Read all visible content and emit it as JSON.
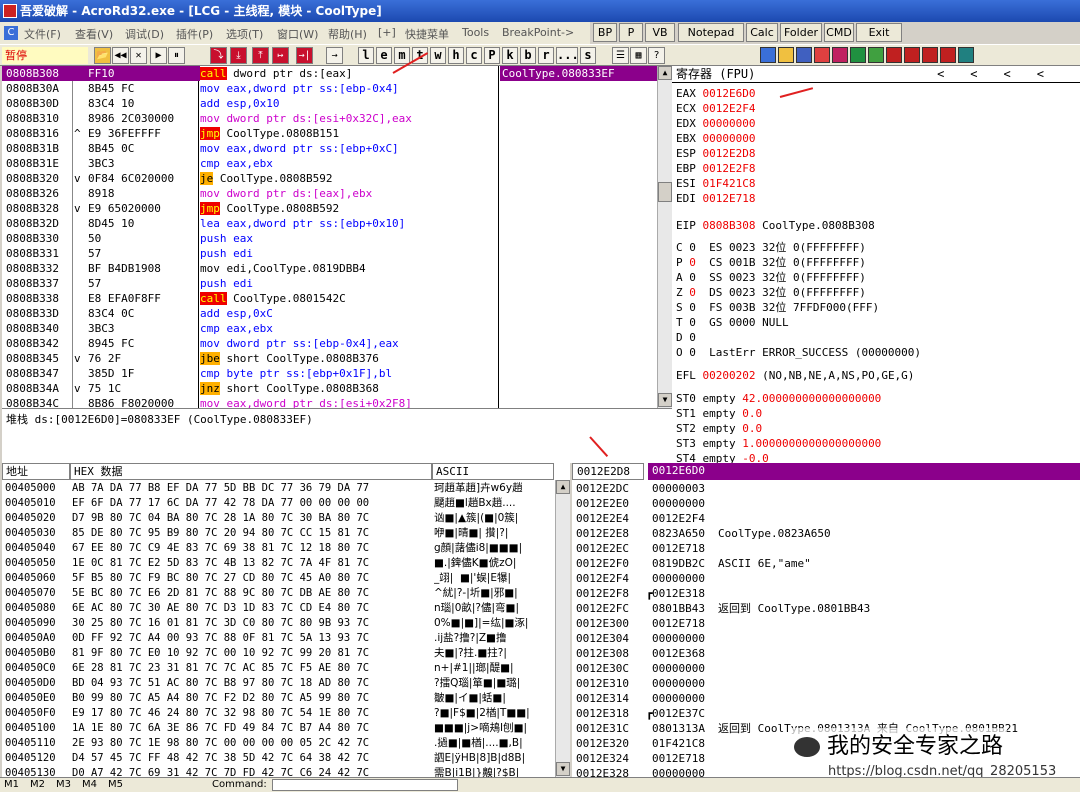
{
  "window": {
    "title": "吾爱破解 - AcroRd32.exe - [LCG - 主线程, 模块 - CoolType]",
    "buttons": [
      "BP",
      "P",
      "VB",
      "Notepad",
      "Calc",
      "Folder",
      "CMD",
      "Exit"
    ]
  },
  "menu": [
    "文件(F)",
    "查看(V)",
    "调试(D)",
    "插件(P)",
    "选项(T)",
    "窗口(W)",
    "帮助(H)",
    "[+]",
    "快捷菜单",
    "Tools",
    "BreakPoint->"
  ],
  "toolbar": {
    "status": "暂停",
    "buttons": [
      "📂",
      "◀◀",
      "✕",
      "▶",
      "⏸",
      "⤵",
      "⤓",
      "⤒",
      "↦",
      "→|"
    ],
    "letters": [
      "l",
      "e",
      "m",
      "t",
      "w",
      "h",
      "c",
      "P",
      "k",
      "b",
      "r",
      "...",
      "s"
    ]
  },
  "disasm": {
    "rows": [
      {
        "addr": "0808B308",
        "hex": "FF10",
        "op": "call",
        "args": " dword ptr ds:[eax]",
        "cls": "kw-call",
        "cmt": "CoolType.080833EF",
        "sel": true
      },
      {
        "addr": "0808B30A",
        "hex": "8B45 FC",
        "op": "mov",
        "args": " eax,dword ptr ss:[ebp-0x4]",
        "cls": "kw-blue"
      },
      {
        "addr": "0808B30D",
        "hex": "83C4 10",
        "op": "add",
        "args": " esp,0x10",
        "cls": "kw-blue"
      },
      {
        "addr": "0808B310",
        "hex": "8986 2C030000",
        "op": "mov",
        "args": " dword ptr ds:[esi+0x32C],eax",
        "cls": "kw-pink"
      },
      {
        "addr": "0808B316",
        "hex": "E9 36FEFFFF",
        "op": "jmp",
        "args": " CoolType.0808B151",
        "cls": "kw-jmp",
        "mark": "^"
      },
      {
        "addr": "0808B31B",
        "hex": "8B45 0C",
        "op": "mov",
        "args": " eax,dword ptr ss:[ebp+0xC]",
        "cls": "kw-blue"
      },
      {
        "addr": "0808B31E",
        "hex": "3BC3",
        "op": "cmp",
        "args": " eax,ebx",
        "cls": "kw-blue"
      },
      {
        "addr": "0808B320",
        "hex": "0F84 6C020000",
        "op": "je",
        "args": " CoolType.0808B592",
        "cls": "kw-jcc",
        "mark": "v"
      },
      {
        "addr": "0808B326",
        "hex": "8918",
        "op": "mov",
        "args": " dword ptr ds:[eax],ebx",
        "cls": "kw-pink"
      },
      {
        "addr": "0808B328",
        "hex": "E9 65020000",
        "op": "jmp",
        "args": " CoolType.0808B592",
        "cls": "kw-jmp",
        "mark": "v"
      },
      {
        "addr": "0808B32D",
        "hex": "8D45 10",
        "op": "lea",
        "args": " eax,dword ptr ss:[ebp+0x10]",
        "cls": "kw-blue"
      },
      {
        "addr": "0808B330",
        "hex": "50",
        "op": "push",
        "args": " eax",
        "cls": "kw-blue"
      },
      {
        "addr": "0808B331",
        "hex": "57",
        "op": "push",
        "args": " edi",
        "cls": "kw-blue"
      },
      {
        "addr": "0808B332",
        "hex": "BF B4DB1908",
        "op": "mov",
        "args": " edi,CoolType.0819DBB4",
        "cls": "kw-plain"
      },
      {
        "addr": "0808B337",
        "hex": "57",
        "op": "push",
        "args": " edi",
        "cls": "kw-blue"
      },
      {
        "addr": "0808B338",
        "hex": "E8 EFA0F8FF",
        "op": "call",
        "args": " CoolType.0801542C",
        "cls": "kw-call"
      },
      {
        "addr": "0808B33D",
        "hex": "83C4 0C",
        "op": "add",
        "args": " esp,0xC",
        "cls": "kw-blue"
      },
      {
        "addr": "0808B340",
        "hex": "3BC3",
        "op": "cmp",
        "args": " eax,ebx",
        "cls": "kw-blue"
      },
      {
        "addr": "0808B342",
        "hex": "8945 FC",
        "op": "mov",
        "args": " dword ptr ss:[ebp-0x4],eax",
        "cls": "kw-blue"
      },
      {
        "addr": "0808B345",
        "hex": "76 2F",
        "op": "jbe",
        "args": " short CoolType.0808B376",
        "cls": "kw-jcc",
        "mark": "v"
      },
      {
        "addr": "0808B347",
        "hex": "385D 1F",
        "op": "cmp",
        "args": " byte ptr ss:[ebp+0x1F],bl",
        "cls": "kw-blue"
      },
      {
        "addr": "0808B34A",
        "hex": "75 1C",
        "op": "jnz",
        "args": " short CoolType.0808B368",
        "cls": "kw-jcc",
        "mark": "v"
      },
      {
        "addr": "0808B34C",
        "hex": "8B86 F8020000",
        "op": "mov",
        "args": " eax,dword ptr ds:[esi+0x2F8]",
        "cls": "kw-pink"
      }
    ]
  },
  "info_line": "堆栈 ds:[0012E6D0]=080833EF (CoolType.080833EF)",
  "registers": {
    "header": "寄存器 (FPU)",
    "nav": [
      "<",
      "<",
      "<",
      "<"
    ],
    "gprs": [
      {
        "name": "EAX",
        "value": "0012E6D0"
      },
      {
        "name": "ECX",
        "value": "0012E2F4"
      },
      {
        "name": "EDX",
        "value": "00000000"
      },
      {
        "name": "EBX",
        "value": "00000000"
      },
      {
        "name": "ESP",
        "value": "0012E2D8"
      },
      {
        "name": "EBP",
        "value": "0012E2F8"
      },
      {
        "name": "ESI",
        "value": "01F421C8"
      },
      {
        "name": "EDI",
        "value": "0012E718"
      }
    ],
    "eip": {
      "name": "EIP",
      "value": "0808B308",
      "desc": "CoolType.0808B308"
    },
    "flags": [
      {
        "f": "C",
        "v": "0",
        "seg": "ES 0023 32位 0(FFFFFFFF)",
        "red": false
      },
      {
        "f": "P",
        "v": "0",
        "seg": "CS 001B 32位 0(FFFFFFFF)",
        "red": true
      },
      {
        "f": "A",
        "v": "0",
        "seg": "SS 0023 32位 0(FFFFFFFF)",
        "red": false
      },
      {
        "f": "Z",
        "v": "0",
        "seg": "DS 0023 32位 0(FFFFFFFF)",
        "red": true
      },
      {
        "f": "S",
        "v": "0",
        "seg": "FS 003B 32位 7FFDF000(FFF)",
        "red": false
      },
      {
        "f": "T",
        "v": "0",
        "seg": "GS 0000 NULL",
        "red": false
      },
      {
        "f": "D",
        "v": "0",
        "seg": "",
        "red": false
      },
      {
        "f": "O",
        "v": "0",
        "seg": "LastErr ERROR_SUCCESS (00000000)",
        "red": false
      }
    ],
    "efl": {
      "name": "EFL",
      "value": "00200202",
      "desc": "(NO,NB,NE,A,NS,PO,GE,G)"
    },
    "fpu": [
      {
        "name": "ST0 empty",
        "value": "42.000000000000000000"
      },
      {
        "name": "ST1 empty",
        "value": "0.0"
      },
      {
        "name": "ST2 empty",
        "value": "0.0"
      },
      {
        "name": "ST3 empty",
        "value": "1.0000000000000000000"
      },
      {
        "name": "ST4 empty",
        "value": "-0.0"
      }
    ]
  },
  "dump": {
    "headers": [
      "地址",
      "HEX 数据",
      "ASCII"
    ],
    "rows": [
      {
        "a": "00405000",
        "h": "AB 7A DA 77 B8 EF DA 77 5D BB DC 77 36 79 DA 77",
        "s": "珂趙革趙]卉w6y趙"
      },
      {
        "a": "00405010",
        "h": "EF 6F DA 77 17 6C DA 77 42 78 DA 77 00 00 00 00",
        "s": "飅趙■l趙Bx趙...."
      },
      {
        "a": "00405020",
        "h": "D7 9B 80 7C 04 BA 80 7C 28 1A 80 7C 30 BA 80 7C",
        "s": "讻■|▲簇|(■|0簇|"
      },
      {
        "a": "00405030",
        "h": "85 DE 80 7C 95 B9 80 7C 20 94 80 7C CC 15 81 7C",
        "s": "咿■|晴■| 攢|?|"
      },
      {
        "a": "00405040",
        "h": "67 EE 80 7C C9 4E 83 7C 69 38 81 7C 12 18 80 7C",
        "s": "g顏|藷儘i8|■■■|"
      },
      {
        "a": "00405050",
        "h": "1E 0C 81 7C E2 5D 83 7C 4B 13 82 7C 7A 4F 81 7C",
        "s": "■.|錍儘K■俿zO|"
      },
      {
        "a": "00405060",
        "h": "5F B5 80 7C F9 BC 80 7C 27 CD 80 7C 45 A0 80 7C",
        "s": "_翊|  ■|'蜈|E犦|"
      },
      {
        "a": "00405070",
        "h": "5E BC 80 7C E6 2D 81 7C 88 9C 80 7C DB AE 80 7C",
        "s": "^紌|?-|圻■|邪■|"
      },
      {
        "a": "00405080",
        "h": "6E AC 80 7C 30 AE 80 7C D3 1D 83 7C CD E4 80 7C",
        "s": "n瑙|0畝|?儘|弯■|"
      },
      {
        "a": "00405090",
        "h": "30 25 80 7C 16 01 81 7C 3D C0 80 7C 80 9B 93 7C",
        "s": "0%■|■]|=纮|■涿|"
      },
      {
        "a": "004050A0",
        "h": "0D FF 92 7C A4 00 93 7C 88 0F 81 7C 5A 13 93 7C",
        "s": ".ij盐?撸?|Z■撸"
      },
      {
        "a": "004050B0",
        "h": "81 9F 80 7C E0 10 92 7C 00 10 92 7C 99 20 81 7C",
        "s": "夫■|?拄.■拄?|"
      },
      {
        "a": "004050C0",
        "h": "6E 28 81 7C 23 31 81 7C 7C AC 85 7C F5 AE 80 7C",
        "s": "n+|#1||瑯|醍■|"
      },
      {
        "a": "004050D0",
        "h": "BD 04 93 7C 51 AC 80 7C B8 97 80 7C 18 AD 80 7C",
        "s": "?擂Q瑙|箪■|■璐|"
      },
      {
        "a": "004050E0",
        "h": "B0 99 80 7C A5 A4 80 7C F2 D2 80 7C A5 99 80 7C",
        "s": "皺■|イ■|蛞■|"
      },
      {
        "a": "004050F0",
        "h": "E9 17 80 7C 46 24 80 7C 32 98 80 7C 54 1E 80 7C",
        "s": "?■|F$■|2楢|T■■|"
      },
      {
        "a": "00405100",
        "h": "1A 1E 80 7C 6A 3E 86 7C FD 49 84 7C B7 A4 80 7C",
        "s": "■■■|j>嘀鳺I刨■|"
      },
      {
        "a": "00405110",
        "h": "2E 93 80 7C 1E 98 80 7C 00 00 00 00 05 2C 42 7C",
        "s": ".撾■|■楢|....■,B|"
      },
      {
        "a": "00405120",
        "h": "D4 57 45 7C FF 48 42 7C 38 5D 42 7C 64 38 42 7C",
        "s": "訵E|ÿHB|8]B|d8B|"
      },
      {
        "a": "00405130",
        "h": "D0 A7 42 7C 69 31 42 7C 7D FD 42 7C C6 24 42 7C",
        "s": "需B|i1B|}齅|?$B|"
      }
    ]
  },
  "stack": {
    "header_addr": "0012E2D8",
    "header_val": "0012E6D0",
    "rows": [
      {
        "a": "0012E2DC",
        "v": "00000003",
        "c": ""
      },
      {
        "a": "0012E2E0",
        "v": "00000000",
        "c": ""
      },
      {
        "a": "0012E2E4",
        "v": "0012E2F4",
        "c": ""
      },
      {
        "a": "0012E2E8",
        "v": "0823A650",
        "c": "CoolType.0823A650"
      },
      {
        "a": "0012E2EC",
        "v": "0012E718",
        "c": ""
      },
      {
        "a": "0012E2F0",
        "v": "0819DB2C",
        "c": "ASCII 6E,\"ame\""
      },
      {
        "a": "0012E2F4",
        "v": "00000000",
        "c": ""
      },
      {
        "a": "0012E2F8",
        "v": "0012E318",
        "c": "",
        "m": "┏"
      },
      {
        "a": "0012E2FC",
        "v": "0801BB43",
        "c": "返回到 CoolType.0801BB43"
      },
      {
        "a": "0012E300",
        "v": "0012E718",
        "c": ""
      },
      {
        "a": "0012E304",
        "v": "00000000",
        "c": ""
      },
      {
        "a": "0012E308",
        "v": "0012E368",
        "c": ""
      },
      {
        "a": "0012E30C",
        "v": "00000000",
        "c": ""
      },
      {
        "a": "0012E310",
        "v": "00000000",
        "c": ""
      },
      {
        "a": "0012E314",
        "v": "00000000",
        "c": ""
      },
      {
        "a": "0012E318",
        "v": "0012E37C",
        "c": "",
        "m": "┏"
      },
      {
        "a": "0012E31C",
        "v": "0801313A",
        "c": "返回到 CoolType.0801313A 来自 CoolType.0801BB21"
      },
      {
        "a": "0012E320",
        "v": "01F421C8",
        "c": ""
      },
      {
        "a": "0012E324",
        "v": "0012E718",
        "c": ""
      },
      {
        "a": "0012E328",
        "v": "00000000",
        "c": ""
      }
    ]
  },
  "status": {
    "tabs": [
      "M1",
      "M2",
      "M3",
      "M4",
      "M5"
    ],
    "command_label": "Command:"
  },
  "watermark": {
    "text": "我的安全专家之路",
    "url": "https://blog.csdn.net/qq_28205153"
  }
}
